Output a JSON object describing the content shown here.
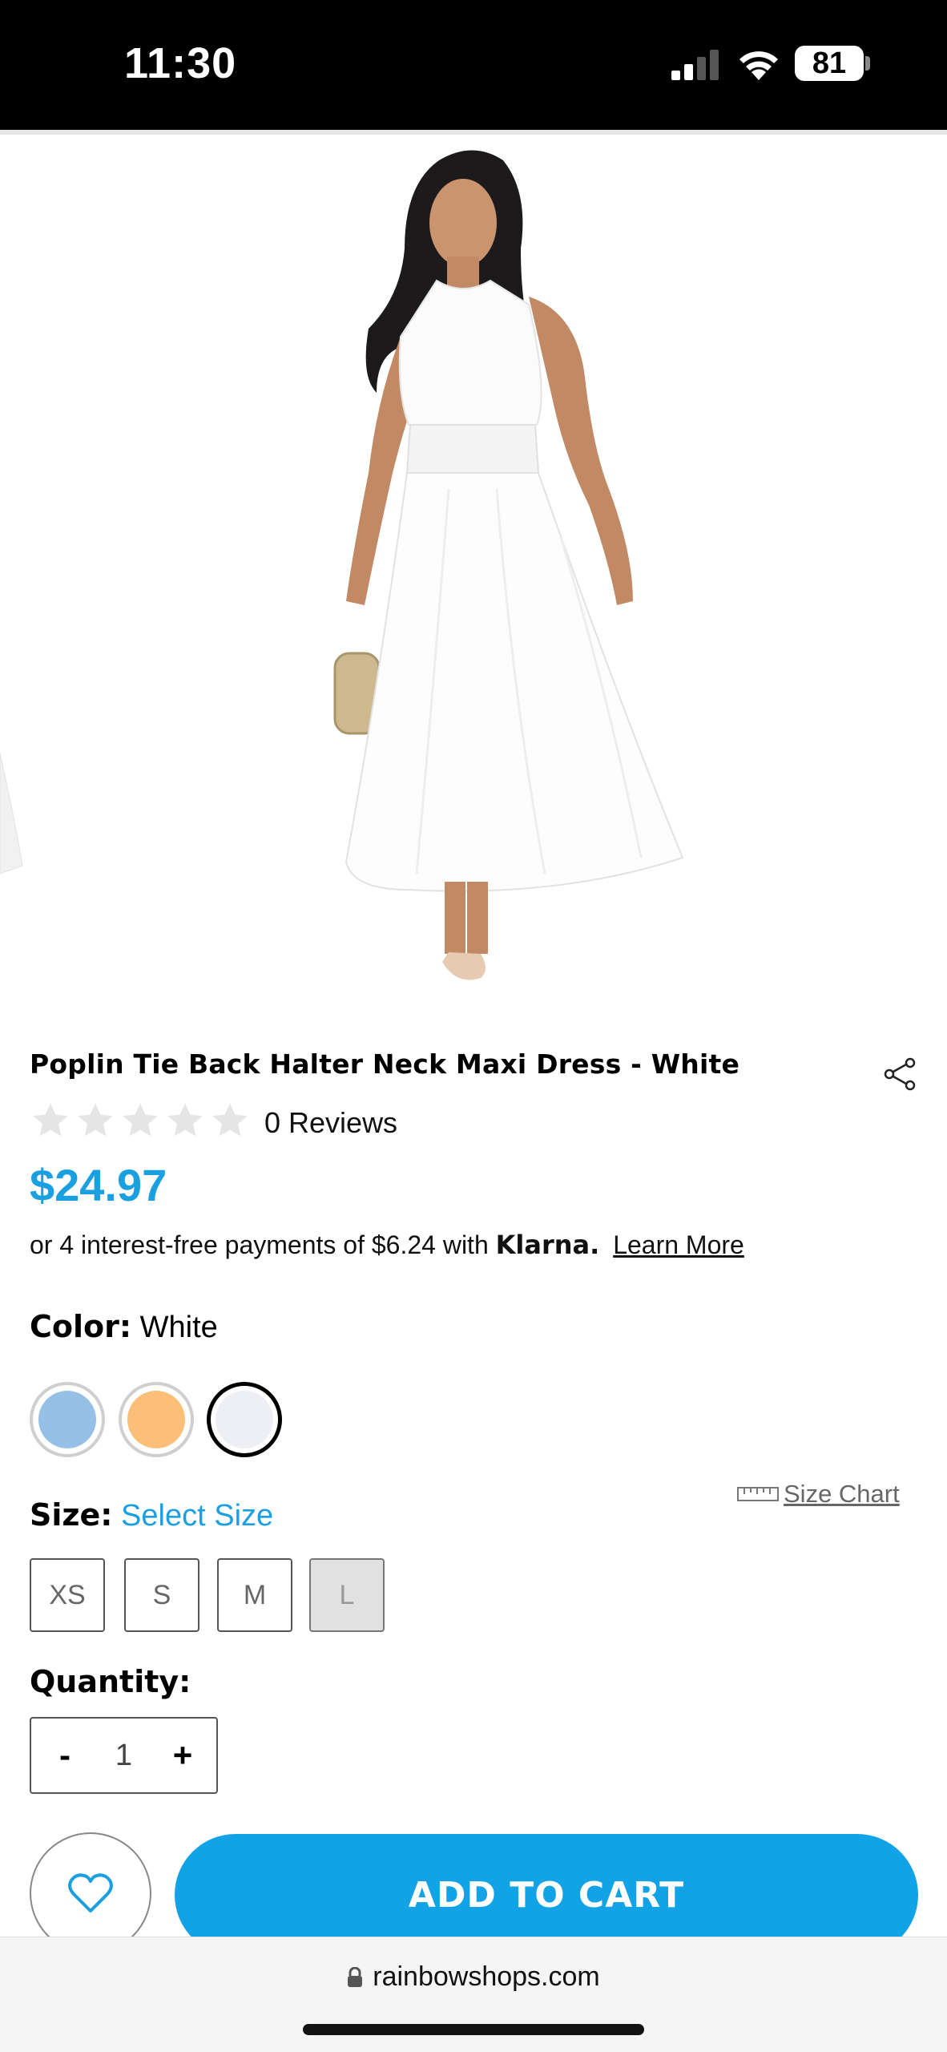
{
  "status_bar": {
    "time": "11:30",
    "battery": "81"
  },
  "product": {
    "title": "Poplin Tie Back Halter Neck Maxi Dress - White",
    "rating_stars": 0,
    "reviews": "0 Reviews",
    "price": "$24.97",
    "price_color": "#1aa0e0"
  },
  "klarna": {
    "prefix": "or",
    "text": "4 interest-free payments of $6.24 with",
    "brand": "Klarna.",
    "link": "Learn More"
  },
  "color": {
    "label": "Color:",
    "selected": "White",
    "swatches": [
      {
        "name": "light-blue",
        "hex": "#97c0e6"
      },
      {
        "name": "orange",
        "hex": "#fcbf78"
      },
      {
        "name": "white",
        "hex": "#eeeef5"
      }
    ]
  },
  "size": {
    "label": "Size:",
    "prompt": "Select Size",
    "chart_link": "Size Chart",
    "options": [
      "XS",
      "S",
      "M",
      "L"
    ],
    "unavailable": [
      "L"
    ]
  },
  "quantity": {
    "label": "Quantity:",
    "minus": "-",
    "value": "1",
    "plus": "+"
  },
  "actions": {
    "add_to_cart": "ADD TO CART",
    "accent": "#12a3e6"
  },
  "browser": {
    "url": "rainbowshops.com"
  }
}
